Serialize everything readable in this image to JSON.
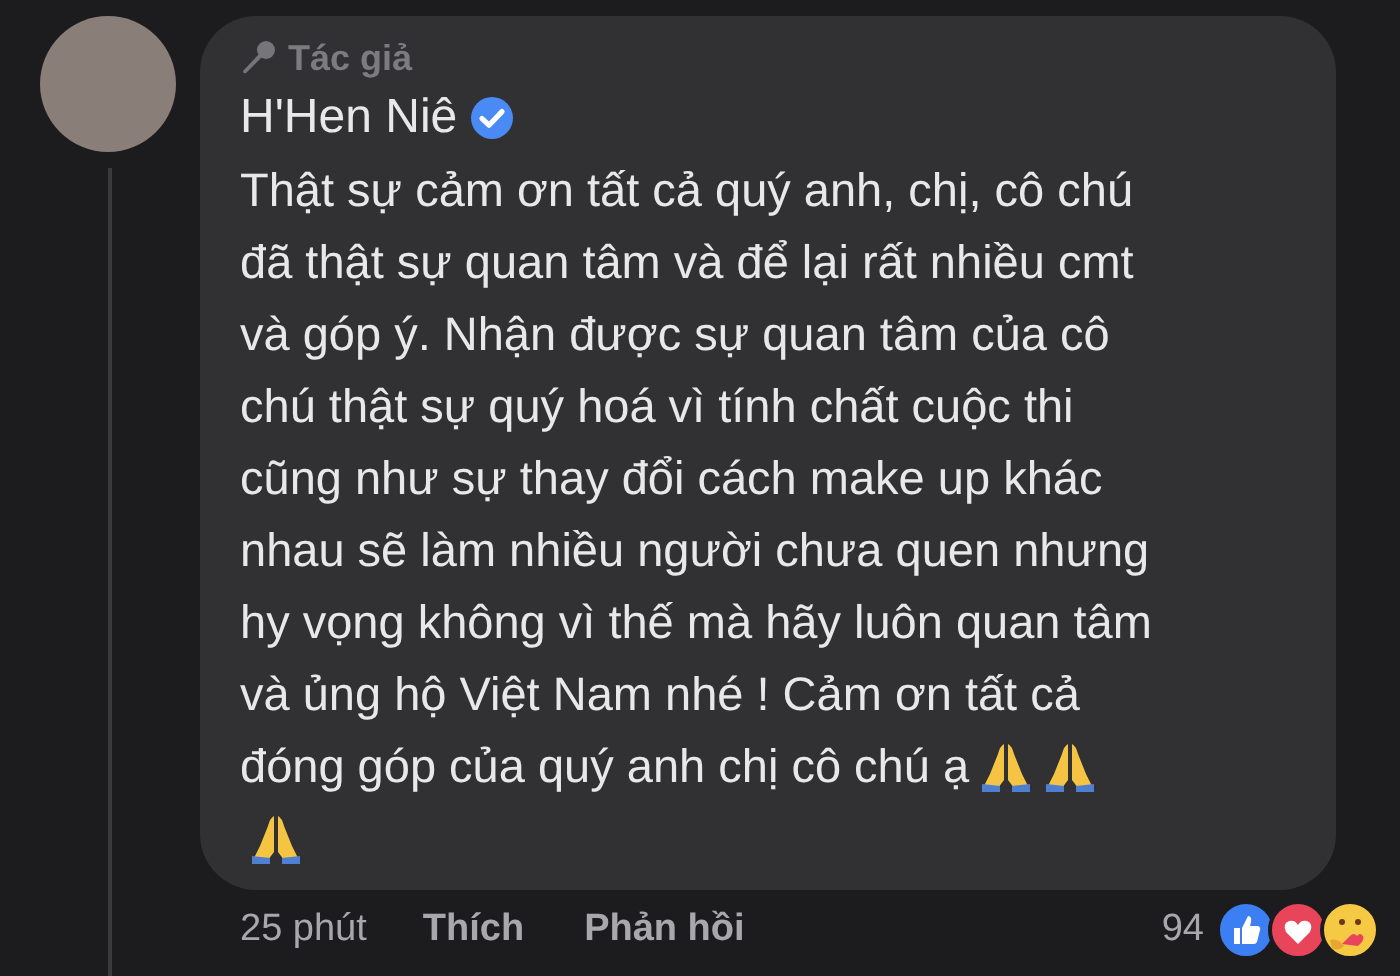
{
  "comment": {
    "badge": "Tác giả",
    "author": "H'Hen Niê",
    "verified": true,
    "lines": [
      {
        "text": "Thật sự cảm ơn tất cả quý anh, chị, cô chú"
      },
      {
        "text": "đã thật sự quan tâm và để lại rất nhiều cmt"
      },
      {
        "text": "và góp ý. Nhận được sự quan tâm của cô"
      },
      {
        "text": "chú thật sự quý hoá vì tính chất cuộc thi"
      },
      {
        "text": "cũng như sự thay đổi cách make up khác"
      },
      {
        "text": "nhau sẽ làm nhiều người chưa quen nhưng"
      },
      {
        "text": "hy vọng không vì thế mà hãy luôn quan tâm"
      },
      {
        "text": "và ủng hộ Việt Nam nhé ! Cảm ơn tất cả"
      },
      {
        "text": "đóng góp của quý anh chị cô chú ạ",
        "emoji": [
          {
            "kind": "folded-hands"
          },
          {
            "kind": "folded-hands"
          }
        ]
      },
      {
        "emoji": [
          {
            "kind": "folded-hands"
          }
        ]
      }
    ],
    "time": "25 phút",
    "actions": [
      "Thích",
      "Phản hồi"
    ],
    "reaction_count": "94",
    "reactions": [
      {
        "kind": "like"
      },
      {
        "kind": "love"
      },
      {
        "kind": "care"
      }
    ]
  }
}
